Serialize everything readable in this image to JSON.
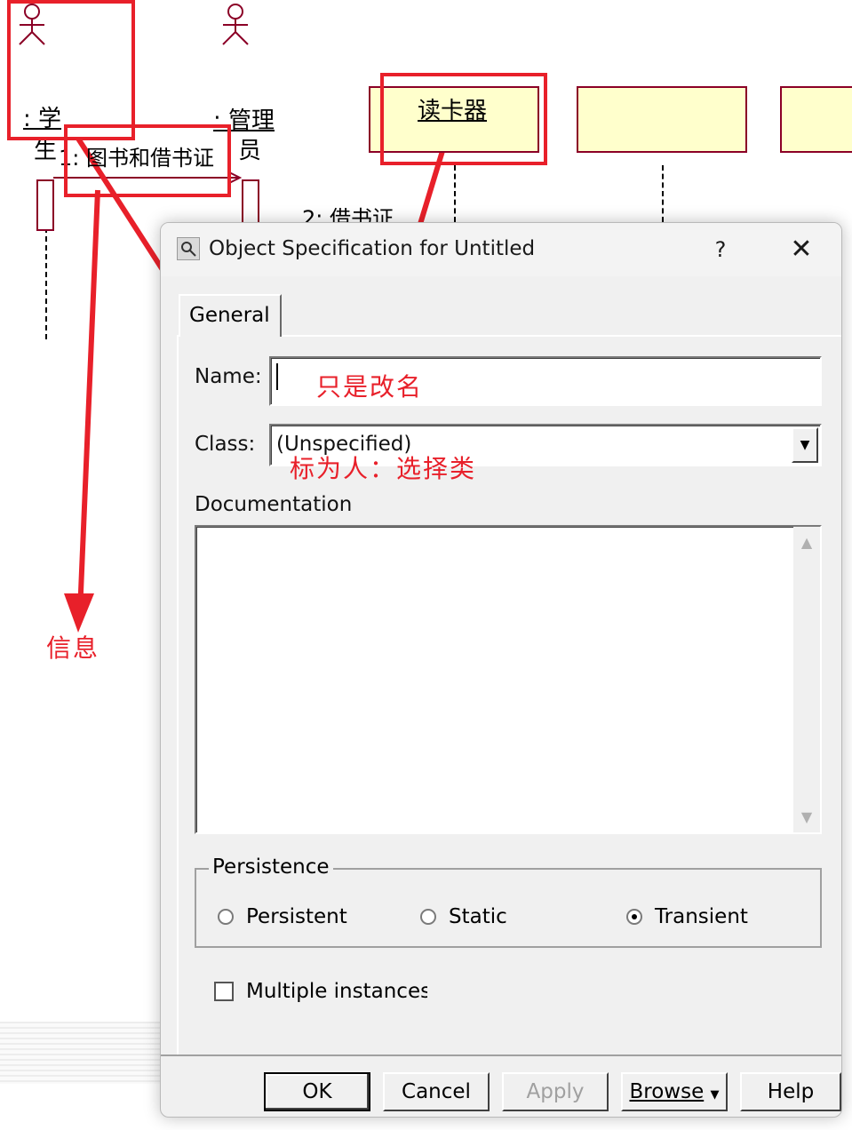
{
  "diagram": {
    "actor_student_label_1": ": 学",
    "actor_student_label_2": "生",
    "actor_librarian_label_1": ": 管理",
    "actor_librarian_label_2": "员",
    "object_reader_label": "读卡器",
    "message_1": "1: 图书和借书证",
    "message_2": "2: 借书证"
  },
  "annotations": {
    "rename_note": "只是改名",
    "class_note": "标为人：选择类",
    "message_note": "信息",
    "color": "#e8202a"
  },
  "dialog": {
    "title": "Object Specification for Untitled",
    "help_label": "?",
    "close_label": "✕",
    "tab_general": "General",
    "name_label": "Name:",
    "name_value": "",
    "class_label": "Class:",
    "class_value": "(Unspecified)",
    "documentation_label": "Documentation",
    "persistence_label": "Persistence",
    "radio_persistent": "Persistent",
    "radio_static": "Static",
    "radio_transient": "Transient",
    "selected_persistence": "Transient",
    "multiple_instances_label": "Multiple instances",
    "multiple_instances_checked": false,
    "buttons": {
      "ok": "OK",
      "cancel": "Cancel",
      "apply": "Apply",
      "browse": "Browse",
      "help": "Help"
    }
  }
}
